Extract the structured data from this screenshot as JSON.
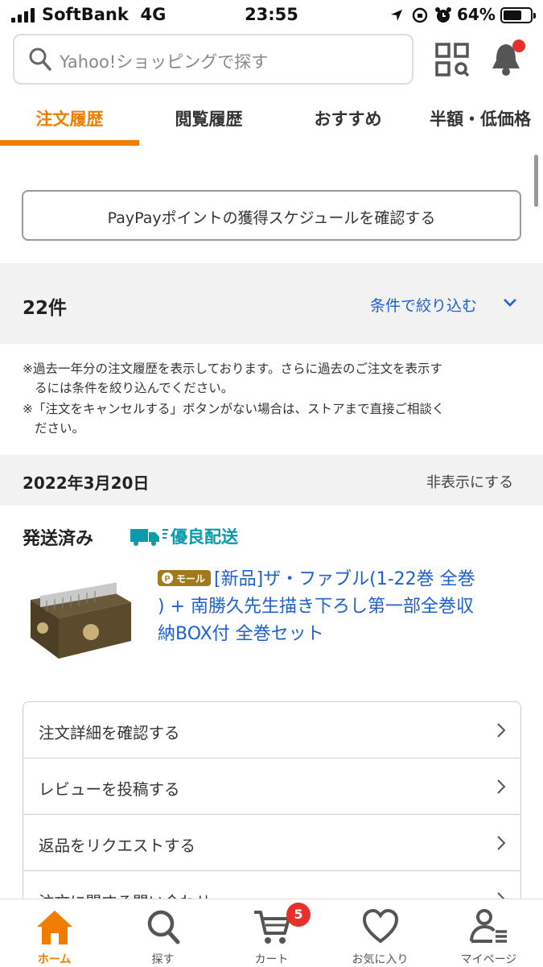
{
  "status_bar": {
    "carrier": "SoftBank",
    "network": "4G",
    "time": "23:55",
    "battery": "64%"
  },
  "header": {
    "search_placeholder": "Yahoo!ショッピングで探す",
    "notification_dot_color": "#e8302a"
  },
  "tabs": [
    {
      "label": "注文履歴",
      "active": true
    },
    {
      "label": "閲覧履歴",
      "active": false
    },
    {
      "label": "おすすめ",
      "active": false
    },
    {
      "label": "半額・低価格",
      "active": false
    }
  ],
  "paypay_button": "PayPayポイントの獲得スケジュールを確認する",
  "summary": {
    "count": "22件",
    "filter_label": "条件で絞り込む"
  },
  "notes": [
    {
      "line1": "※過去一年分の注文履歴を表示しております。さらに過去のご注文を表示す",
      "line2": "るには条件を絞り込んでください。"
    },
    {
      "line1": "※「注文をキャンセルする」ボタンがない場合は、ストアまで直接ご相談く",
      "line2": "ださい。"
    }
  ],
  "order": {
    "date": "2022年3月20日",
    "hide_label": "非表示にする",
    "status": "発送済み",
    "delivery_badge": "優良配送",
    "mall_badge": "モール",
    "product_title_lines": [
      "[新品]ザ・ファブル(1-22巻 全巻",
      ") + 南勝久先生描き下ろし第一部全巻収",
      "納BOX付 全巻セット"
    ],
    "actions": [
      "注文詳細を確認する",
      "レビューを投稿する",
      "返品をリクエストする",
      "注文に関する問い合わせ"
    ]
  },
  "bottom_nav": [
    {
      "label": "ホーム",
      "icon": "home-icon",
      "active": true
    },
    {
      "label": "探す",
      "icon": "search-icon",
      "active": false
    },
    {
      "label": "カート",
      "icon": "cart-icon",
      "active": false,
      "badge": "5"
    },
    {
      "label": "お気に入り",
      "icon": "heart-icon",
      "active": false
    },
    {
      "label": "マイページ",
      "icon": "person-icon",
      "active": false
    }
  ],
  "colors": {
    "accent": "#f07d00",
    "link": "#1e5fd1",
    "delivery": "#0a9aa8"
  }
}
